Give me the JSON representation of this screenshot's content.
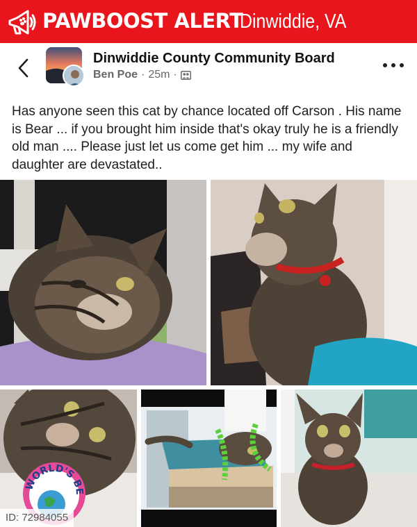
{
  "banner": {
    "brand": "PAWBOOST ALERT",
    "location": "Dinwiddie, VA",
    "background_color": "#e8161c",
    "icon": "megaphone-paw-icon"
  },
  "post": {
    "group_name": "Dinwiddie County Community Board",
    "author": "Ben Poe",
    "separator": "·",
    "time": "25m",
    "privacy_icon": "members-icon",
    "text": "Has anyone seen this cat by chance located off Carson . His name is Bear ... if you brought him inside that's okay truly he is a friendly old man .... Please just let us come get him ... my wife and daughter are devastated.."
  },
  "photos": {
    "badge_text": "WORLD'S BEST"
  },
  "footer": {
    "id_label": "ID: 72984055"
  }
}
